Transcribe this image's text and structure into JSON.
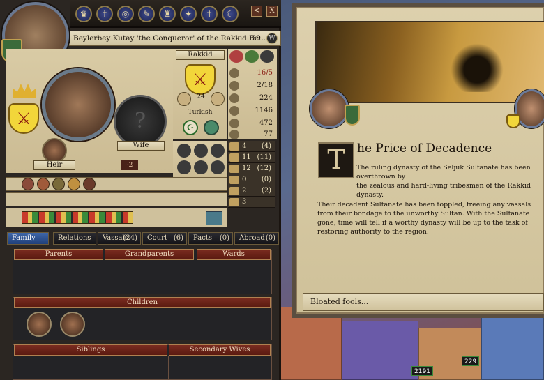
{
  "character": {
    "name_line": "Beylerbey Kutay 'the Conqueror' of the Rakkid Be...",
    "age": "39",
    "heir_label": "Heir",
    "spouse_label": "Wife",
    "heir_value": "-2",
    "dynasty_name": "Rakkid",
    "culture": "Turkish",
    "dynasty_value": "24"
  },
  "topbar_icons": [
    "crown-icon",
    "sword-icon",
    "coin-icon",
    "scroll-icon",
    "castle-icon",
    "treaty-icon",
    "cross-icon",
    "crescent-icon"
  ],
  "window_controls": {
    "back": "<",
    "close": "X"
  },
  "attributes": [
    {
      "icon": "prestige-icon",
      "value": "16/5",
      "color": "#8a1a10"
    },
    {
      "icon": "levy-icon",
      "value": "2/18"
    },
    {
      "icon": "diplomacy-icon",
      "value": "224"
    },
    {
      "icon": "gold-icon",
      "value": "1146"
    },
    {
      "icon": "prestige-total-icon",
      "value": "472"
    },
    {
      "icon": "piety-icon",
      "value": "77"
    }
  ],
  "skills": [
    {
      "a": "4",
      "b": "(4)"
    },
    {
      "a": "11",
      "b": "(11)"
    },
    {
      "a": "12",
      "b": "(12)"
    },
    {
      "a": "0",
      "b": "(0)"
    },
    {
      "a": "2",
      "b": "(2)"
    },
    {
      "a": "3",
      "b": ""
    }
  ],
  "tabs": [
    {
      "label": "Family",
      "count": ""
    },
    {
      "label": "Relations",
      "count": ""
    },
    {
      "label": "Vassals",
      "count": "(24)"
    },
    {
      "label": "Court",
      "count": "(6)"
    },
    {
      "label": "Pacts",
      "count": "(0)"
    },
    {
      "label": "Abroad",
      "count": "(0)"
    }
  ],
  "family": {
    "parents": "Parents",
    "grandparents": "Grandparents",
    "wards": "Wards",
    "children": "Children",
    "siblings": "Siblings",
    "secondary_wives": "Secondary Wives"
  },
  "event": {
    "dropcap": "T",
    "title": "he Price of Decadence",
    "line1": "The ruling dynasty of the Seljuk Sultanate has been overthrown by",
    "line2": "the zealous and hard-living tribesmen of the Rakkid dynasty.",
    "body": "Their decadent Sultanate has been toppled, freeing any vassals from their bondage to the unworthy Sultan. With the Sultanate gone, time will tell if a worthy dynasty will be up to the task of restoring authority to the region.",
    "option": "Bloated fools..."
  },
  "map": {
    "army1": "2191",
    "army2": "229"
  }
}
